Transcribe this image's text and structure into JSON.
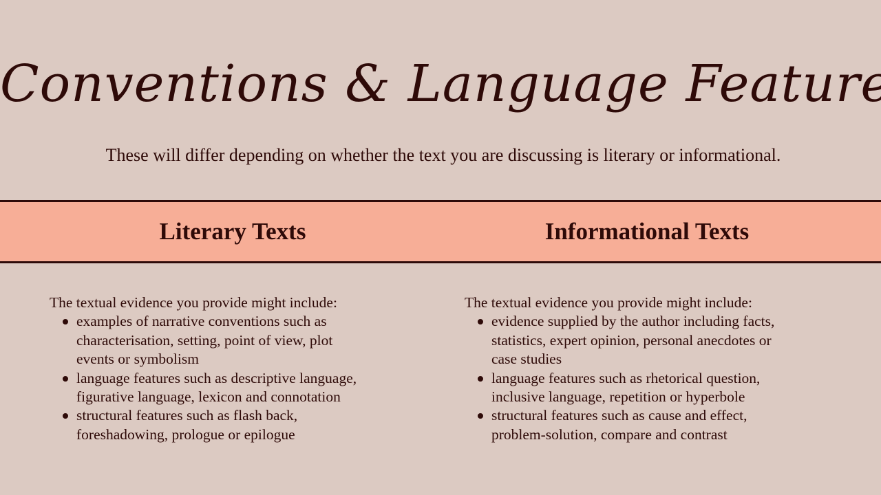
{
  "title": "Conventions & Language Features",
  "subtitle": "These will differ depending on whether the text you are discussing is literary or informational.",
  "colors": {
    "background": "#dccac2",
    "band": "#f7ae97",
    "text": "#2e0a08"
  },
  "literary": {
    "heading": "Literary Texts",
    "intro": "The textual evidence you provide might include:",
    "points": [
      [
        "examples of narrative conventions such as",
        "characterisation, setting, point of view, plot",
        "events or symbolism"
      ],
      [
        "language features such as descriptive language,",
        "figurative language, lexicon and connotation"
      ],
      [
        "structural features such as flash back,",
        "foreshadowing, prologue or epilogue"
      ]
    ]
  },
  "informational": {
    "heading": "Informational Texts",
    "intro": "The textual evidence you provide might include:",
    "points": [
      [
        "evidence supplied by the author including facts,",
        "statistics, expert opinion, personal anecdotes or",
        "case studies"
      ],
      [
        "language features such as rhetorical question,",
        "inclusive language, repetition or hyperbole"
      ],
      [
        "structural features such as cause and effect,",
        "problem-solution, compare and contrast"
      ]
    ]
  }
}
